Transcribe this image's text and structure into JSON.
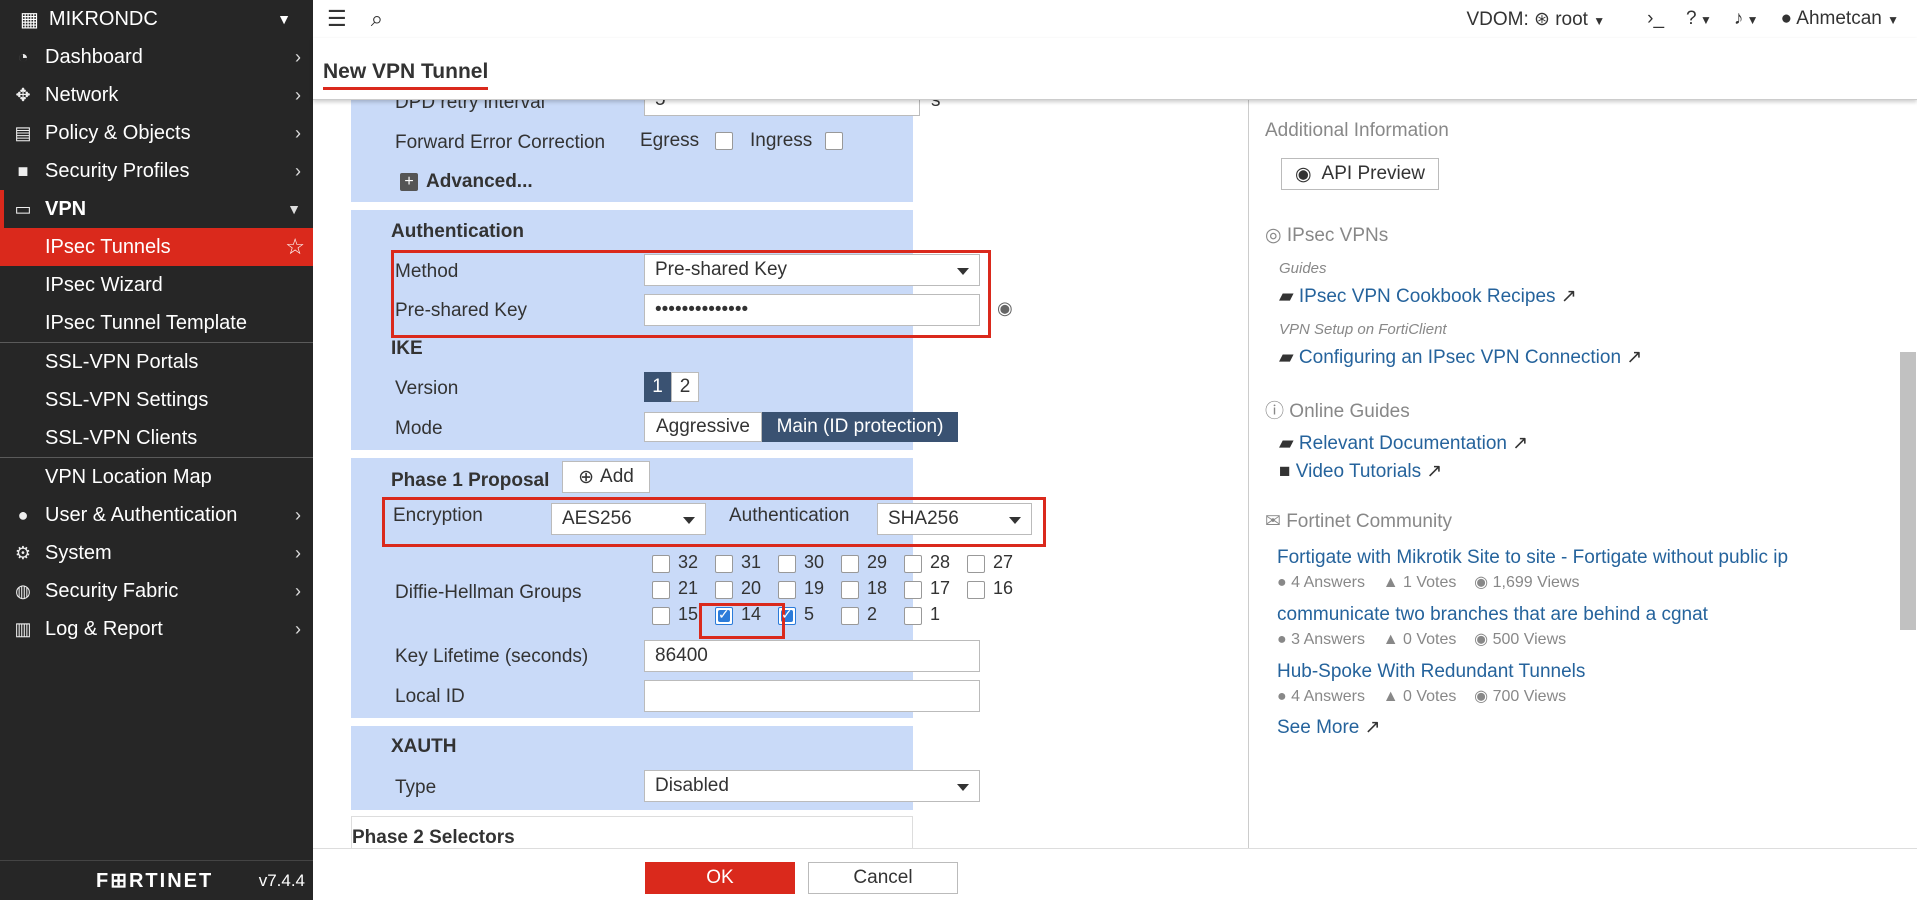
{
  "sidebar": {
    "device": "MIKRONDC",
    "items": [
      {
        "label": "Dashboard"
      },
      {
        "label": "Network"
      },
      {
        "label": "Policy & Objects"
      },
      {
        "label": "Security Profiles"
      },
      {
        "label": "VPN"
      }
    ],
    "vpn_sub": [
      "IPsec Tunnels",
      "IPsec Wizard",
      "IPsec Tunnel Template",
      "SSL-VPN Portals",
      "SSL-VPN Settings",
      "SSL-VPN Clients",
      "VPN Location Map"
    ],
    "items2": [
      {
        "label": "User & Authentication"
      },
      {
        "label": "System"
      },
      {
        "label": "Security Fabric"
      },
      {
        "label": "Log & Report"
      }
    ],
    "logo": "F⊞RTINET",
    "version": "v7.4.4"
  },
  "topbar": {
    "vdom_label": "VDOM:",
    "vdom_value": "root",
    "user": "Ahmetcan"
  },
  "page": {
    "title": "New VPN Tunnel"
  },
  "form": {
    "dpd_label": "DPD retry interval",
    "dpd_value": "5",
    "dpd_unit": "s",
    "fec_label": "Forward Error Correction",
    "egress": "Egress",
    "ingress": "Ingress",
    "advanced": "Advanced...",
    "auth_header": "Authentication",
    "method_label": "Method",
    "method_value": "Pre-shared Key",
    "psk_label": "Pre-shared Key",
    "psk_value": "••••••••••••••",
    "ike_header": "IKE",
    "version_label": "Version",
    "version_1": "1",
    "version_2": "2",
    "mode_label": "Mode",
    "mode_aggressive": "Aggressive",
    "mode_main": "Main (ID protection)",
    "phase1_header": "Phase 1 Proposal",
    "add_label": "Add",
    "enc_label": "Encryption",
    "enc_value": "AES256",
    "authn_label": "Authentication",
    "authn_value": "SHA256",
    "dh_label": "Diffie-Hellman Groups",
    "dh_groups": [
      "32",
      "31",
      "30",
      "29",
      "28",
      "27",
      "21",
      "20",
      "19",
      "18",
      "17",
      "16",
      "15",
      "14",
      "5",
      "2",
      "1"
    ],
    "dh_checked": [
      "14",
      "5"
    ],
    "keylife_label": "Key Lifetime (seconds)",
    "keylife_value": "86400",
    "localid_label": "Local ID",
    "localid_value": "",
    "xauth_header": "XAUTH",
    "type_label": "Type",
    "type_value": "Disabled",
    "phase2_header": "Phase 2 Selectors"
  },
  "footer": {
    "ok": "OK",
    "cancel": "Cancel"
  },
  "right": {
    "additional": "Additional Information",
    "api_preview": "API Preview",
    "ipsec_vpns": "IPsec VPNs",
    "guides": "Guides",
    "cookbook": "IPsec VPN Cookbook Recipes",
    "forticlient": "VPN Setup on FortiClient",
    "configuring": "Configuring an IPsec VPN Connection",
    "online_guides": "Online Guides",
    "relevant": "Relevant Documentation",
    "video": "Video Tutorials",
    "community": "Fortinet Community",
    "posts": [
      {
        "title": "Fortigate with Mikrotik Site to site - Fortigate without public ip",
        "answers": "4",
        "answers_label": "Answers",
        "votes": "1",
        "votes_label": "Votes",
        "views": "1,699",
        "views_label": "Views"
      },
      {
        "title": "communicate two branches that are behind a cgnat",
        "answers": "3",
        "answers_label": "Answers",
        "votes": "0",
        "votes_label": "Votes",
        "views": "500",
        "views_label": "Views"
      },
      {
        "title": "Hub-Spoke With Redundant Tunnels",
        "answers": "4",
        "answers_label": "Answers",
        "votes": "0",
        "votes_label": "Votes",
        "views": "700",
        "views_label": "Views"
      }
    ],
    "see_more": "See More"
  },
  "colors": {
    "accent": "#da291c",
    "panel": "#c9daf8",
    "sidebar": "#262626",
    "link": "#25639c"
  }
}
